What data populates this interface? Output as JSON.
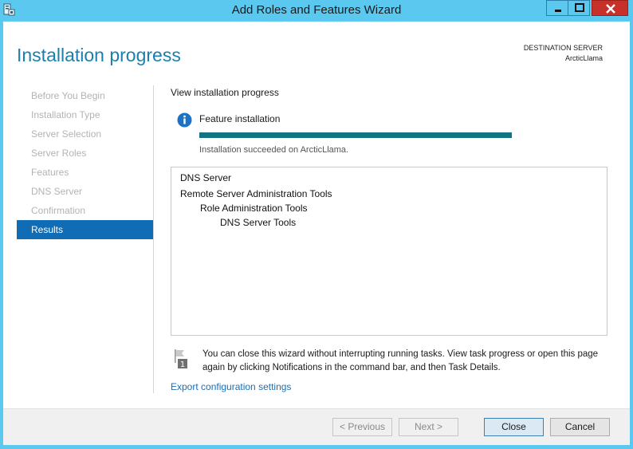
{
  "window": {
    "title": "Add Roles and Features Wizard",
    "controls": {
      "minimize": "minimize",
      "maximize": "maximize",
      "close": "close"
    }
  },
  "header": {
    "title": "Installation progress",
    "destination_label": "DESTINATION SERVER",
    "destination_server": "ArcticLlama"
  },
  "nav": {
    "items": [
      {
        "label": "Before You Begin",
        "active": false
      },
      {
        "label": "Installation Type",
        "active": false
      },
      {
        "label": "Server Selection",
        "active": false
      },
      {
        "label": "Server Roles",
        "active": false
      },
      {
        "label": "Features",
        "active": false
      },
      {
        "label": "DNS Server",
        "active": false
      },
      {
        "label": "Confirmation",
        "active": false
      },
      {
        "label": "Results",
        "active": true
      }
    ]
  },
  "main": {
    "section_label": "View installation progress",
    "feature_label": "Feature installation",
    "progress_fraction": 1.0,
    "status": "Installation succeeded on ArcticLlama.",
    "results": [
      {
        "label": "DNS Server",
        "level": 0
      },
      {
        "label": "Remote Server Administration Tools",
        "level": 0
      },
      {
        "label": "Role Administration Tools",
        "level": 1
      },
      {
        "label": "DNS Server Tools",
        "level": 2
      }
    ],
    "note": "You can close this wizard without interrupting running tasks. View task progress or open this page again by clicking Notifications in the command bar, and then Task Details.",
    "notification_count": "1",
    "export_link": "Export configuration settings"
  },
  "footer": {
    "previous": "< Previous",
    "next": "Next >",
    "close": "Close",
    "cancel": "Cancel"
  },
  "colors": {
    "accent": "#1b7fae",
    "nav_active": "#0f6cb5",
    "progress": "#147382",
    "titlebar": "#5ac8ef",
    "close_control": "#c7312a"
  }
}
